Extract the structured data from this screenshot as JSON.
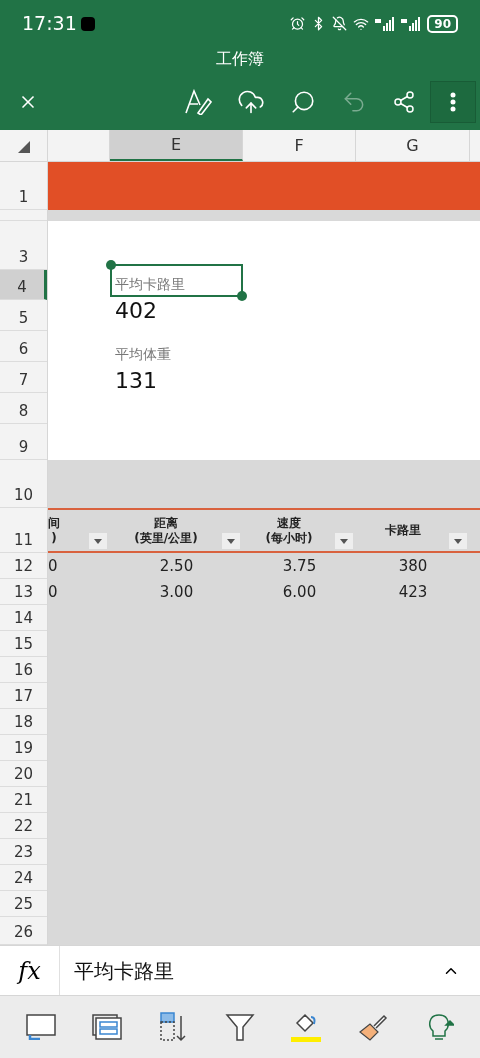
{
  "status_bar": {
    "time": "17:31",
    "battery": "90"
  },
  "window": {
    "title": "工作簿"
  },
  "columns": [
    {
      "label": "E",
      "selected": true
    },
    {
      "label": "F",
      "selected": false
    },
    {
      "label": "G",
      "selected": false
    }
  ],
  "rows": [
    {
      "label": "1",
      "selected": false
    },
    {
      "selected": false
    },
    {
      "label": "3",
      "selected": false
    },
    {
      "label": "4",
      "selected": true
    },
    {
      "label": "5",
      "selected": false
    },
    {
      "label": "6",
      "selected": false
    },
    {
      "label": "7",
      "selected": false
    },
    {
      "label": "8",
      "selected": false
    },
    {
      "label": "9",
      "selected": false
    },
    {
      "label": "10",
      "selected": false
    },
    {
      "label": "11",
      "selected": false
    },
    {
      "label": "12",
      "selected": false
    },
    {
      "label": "13",
      "selected": false
    },
    {
      "label": "14",
      "selected": false
    },
    {
      "label": "15",
      "selected": false
    },
    {
      "label": "16",
      "selected": false
    },
    {
      "label": "17",
      "selected": false
    },
    {
      "label": "18",
      "selected": false
    },
    {
      "label": "19",
      "selected": false
    },
    {
      "label": "20",
      "selected": false
    },
    {
      "label": "21",
      "selected": false
    },
    {
      "label": "22",
      "selected": false
    },
    {
      "label": "23",
      "selected": false
    },
    {
      "label": "24",
      "selected": false
    },
    {
      "label": "25",
      "selected": false
    },
    {
      "label": "26",
      "selected": false
    }
  ],
  "cards": [
    {
      "label": "平均卡路里",
      "value": "402",
      "selected": true
    },
    {
      "label": "平均体重",
      "value": "131",
      "selected": false
    }
  ],
  "table": {
    "columns": [
      {
        "lines": [
          "间",
          ")"
        ]
      },
      {
        "lines": [
          "距离",
          "(英里/公里)"
        ]
      },
      {
        "lines": [
          "速度",
          "(每小时)"
        ]
      },
      {
        "lines": [
          "卡路里"
        ]
      }
    ],
    "rows": [
      [
        "0",
        "2.50",
        "3.75",
        "380"
      ],
      [
        "0",
        "3.00",
        "6.00",
        "423"
      ]
    ]
  },
  "formula_bar": {
    "label": "fx",
    "value": "平均卡路里"
  }
}
